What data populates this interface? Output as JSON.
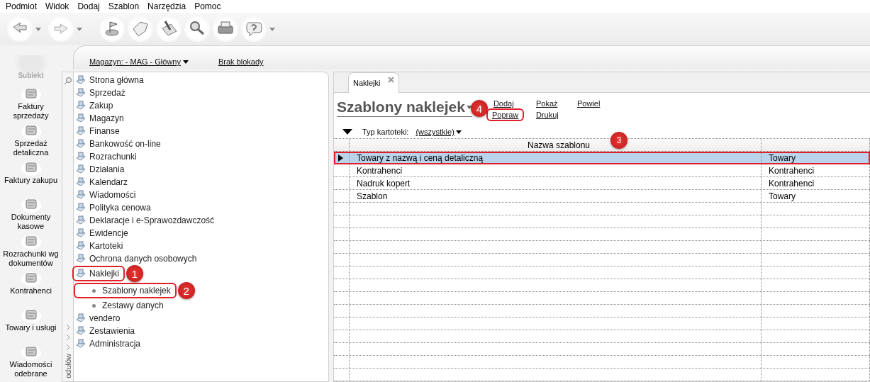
{
  "menu": [
    "Podmiot",
    "Widok",
    "Dodaj",
    "Szablon",
    "Narzędzia",
    "Pomoc"
  ],
  "sidebar": {
    "logo": "Subiekt",
    "modules": [
      {
        "label": "Faktury sprzedaży"
      },
      {
        "label": "Sprzedaż detaliczna"
      },
      {
        "label": "Faktury zakupu"
      },
      {
        "label": "Dokumenty kasowe"
      },
      {
        "label": "Rozrachunki wg dokumentów"
      },
      {
        "label": "Kontrahenci"
      },
      {
        "label": "Towary i usługi"
      },
      {
        "label": "Wiadomości odebrane"
      }
    ]
  },
  "header": {
    "magazyn": "Magazyn: - MAG - Główny",
    "blokada": "Brak blokady"
  },
  "tree": {
    "strip_label": "odułów",
    "items": [
      {
        "label": "Strona główna",
        "highlighted": false
      },
      {
        "label": "Sprzedaż",
        "highlighted": false
      },
      {
        "label": "Zakup",
        "highlighted": false
      },
      {
        "label": "Magazyn",
        "highlighted": false
      },
      {
        "label": "Finanse",
        "highlighted": false
      },
      {
        "label": "Bankowość on-line",
        "highlighted": false
      },
      {
        "label": "Rozrachunki",
        "highlighted": false
      },
      {
        "label": "Działania",
        "highlighted": false
      },
      {
        "label": "Kalendarz",
        "highlighted": false
      },
      {
        "label": "Wiadomości",
        "highlighted": false
      },
      {
        "label": "Polityka cenowa",
        "highlighted": false
      },
      {
        "label": "Deklaracje i e-Sprawozdawczość",
        "highlighted": false
      },
      {
        "label": "Ewidencje",
        "highlighted": false
      },
      {
        "label": "Kartoteki",
        "highlighted": false
      },
      {
        "label": "Ochrona danych osobowych",
        "highlighted": false
      },
      {
        "label": "Naklejki",
        "highlighted": true,
        "badge": "1",
        "children": [
          {
            "label": "Szablony naklejek",
            "highlighted": true,
            "badge": "2"
          },
          {
            "label": "Zestawy danych",
            "highlighted": false
          }
        ]
      },
      {
        "label": "vendero",
        "highlighted": false
      },
      {
        "label": "Zestawienia",
        "highlighted": false
      },
      {
        "label": "Administracja",
        "highlighted": false
      }
    ]
  },
  "tabs": [
    {
      "label": "Naklejki",
      "selected": true
    }
  ],
  "title": "Szablony naklejek",
  "action_rows": [
    {
      "actions": [
        {
          "label": "Dodaj",
          "highlighted": false
        },
        {
          "label": "Pokaż",
          "highlighted": false
        },
        {
          "label": "Powiel",
          "highlighted": false
        }
      ]
    },
    {
      "actions": [
        {
          "label": "Popraw",
          "highlighted": true,
          "badge": "4"
        },
        {
          "label": "Drukuj",
          "highlighted": false
        }
      ]
    }
  ],
  "filter": {
    "label": "Typ kartoteki:",
    "value": "(wszystkie)"
  },
  "table": {
    "columns": [
      "Nazwa szablonu"
    ],
    "badge": "3",
    "rows": [
      {
        "name": "Towary z nazwą i ceną detaliczną",
        "column_2": "Towary",
        "selected": true,
        "highlighted": true
      },
      {
        "name": "Kontrahenci",
        "column_2": "Kontrahenci",
        "selected": false,
        "highlighted": false
      },
      {
        "name": "Nadruk kopert",
        "column_2": "Kontrahenci",
        "selected": false,
        "highlighted": false
      },
      {
        "name": "Szablon",
        "column_2": "Towary",
        "selected": false,
        "highlighted": false
      }
    ]
  }
}
